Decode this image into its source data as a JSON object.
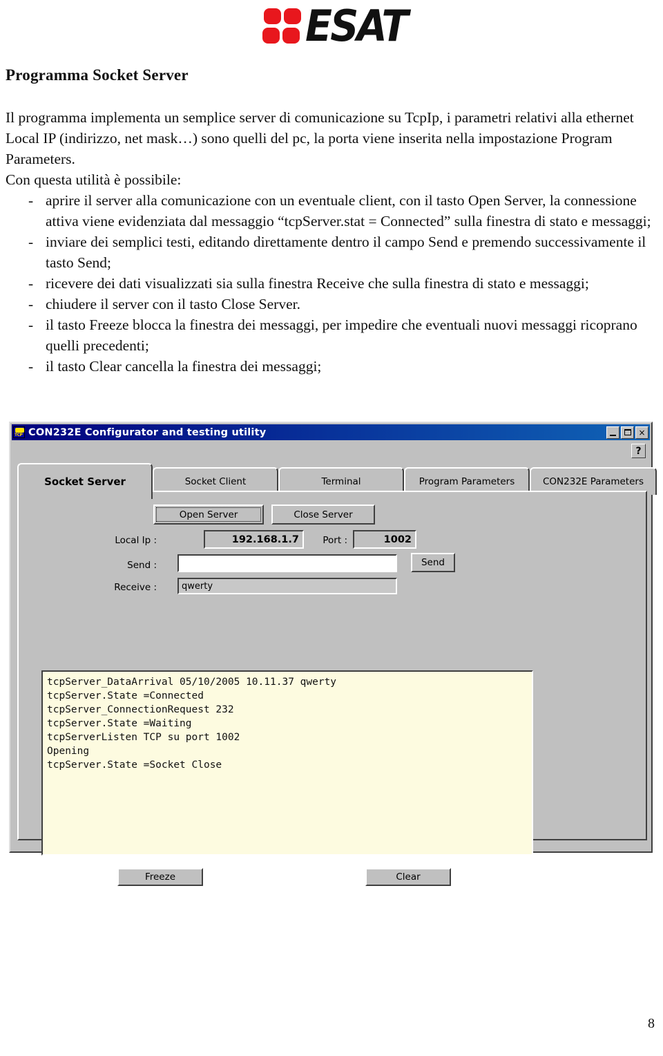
{
  "document": {
    "logo": {
      "mark_name": "esat-logo",
      "wordmark": "ESAT",
      "square_color": "#e8171d"
    },
    "heading": "Programma Socket Server",
    "intro": "Il programma implementa un semplice server di comunicazione su TcpIp,  i parametri relativi alla ethernet Local IP (indirizzo, net mask…) sono quelli del pc, la porta viene inserita nella impostazione Program Parameters.",
    "lead": "Con questa utilità è possibile:",
    "bullet_marker": "-",
    "bullets": [
      "aprire il server alla comunicazione con un eventuale client, con il tasto Open Server, la connessione attiva viene evidenziata dal messaggio “tcpServer.stat  = Connected” sulla finestra di stato e messaggi;",
      "inviare dei semplici testi, editando direttamente dentro il campo Send e premendo successivamente il tasto Send;",
      "ricevere dei dati visualizzati sia sulla finestra Receive che sulla finestra di stato e messaggi;",
      "chiudere il server con il tasto Close Server.",
      "il tasto Freeze blocca la finestra dei messaggi,  per impedire che eventuali nuovi messaggi ricoprano quelli precedenti;",
      "il tasto Clear cancella la finestra dei messaggi;"
    ],
    "page_number": "8"
  },
  "app": {
    "titlebar": {
      "title": "CON232E Configurator and testing utility",
      "icon_label": "TCP",
      "bg_color": "#000080",
      "minimize": "–",
      "maximize": "□",
      "close": "×"
    },
    "help_button": "?",
    "tabs": [
      {
        "label": "Socket Server",
        "active": true
      },
      {
        "label": "Socket Client",
        "active": false
      },
      {
        "label": "Terminal",
        "active": false
      },
      {
        "label": "Program Parameters",
        "active": false
      },
      {
        "label": "CON232E Parameters",
        "active": false
      }
    ],
    "socket_server": {
      "open_server_label": "Open Server",
      "close_server_label": "Close Server",
      "local_ip_label": "Local Ip :",
      "local_ip_value": "192.168.1.7",
      "port_label": "Port :",
      "port_value": "1002",
      "send_label": "Send :",
      "send_value": "",
      "send_button_label": "Send",
      "receive_label": "Receive :",
      "receive_value": "qwerty",
      "log_bg_color": "#fdfbe0",
      "log_lines": [
        "tcpServer_DataArrival 05/10/2005 10.11.37 qwerty",
        "tcpServer.State =Connected",
        "tcpServer_ConnectionRequest 232",
        "tcpServer.State =Waiting",
        "tcpServerListen TCP su port 1002",
        "Opening",
        "tcpServer.State =Socket Close"
      ],
      "freeze_button_label": "Freeze",
      "clear_button_label": "Clear"
    }
  }
}
